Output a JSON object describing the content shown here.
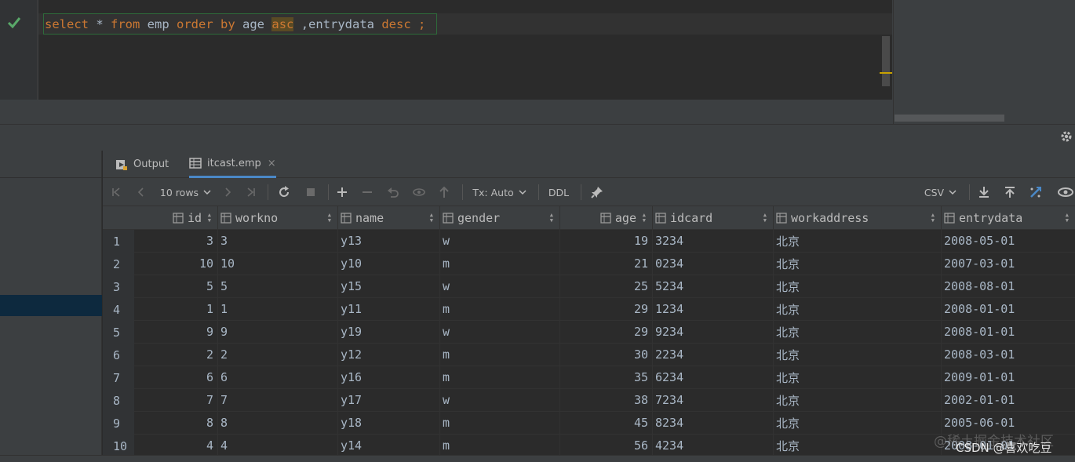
{
  "editor": {
    "query_tokens": [
      {
        "t": "select",
        "c": "kw"
      },
      {
        "t": " * ",
        "c": "plain"
      },
      {
        "t": "from",
        "c": "kw"
      },
      {
        "t": " emp ",
        "c": "plain"
      },
      {
        "t": "order",
        "c": "kw"
      },
      {
        "t": " ",
        "c": "plain"
      },
      {
        "t": "by",
        "c": "kw"
      },
      {
        "t": " age ",
        "c": "fn"
      },
      {
        "t": "asc",
        "c": "hl"
      },
      {
        "t": " ,entrydata ",
        "c": "fn"
      },
      {
        "t": "desc",
        "c": "kw"
      },
      {
        "t": " ;",
        "c": "kw"
      }
    ],
    "status_icon": "check-icon"
  },
  "tabs": [
    {
      "label": "Output",
      "icon": "output-icon",
      "active": false
    },
    {
      "label": "itcast.emp",
      "icon": "table-icon",
      "active": true,
      "close": "×"
    }
  ],
  "toolbar": {
    "rows_label": "10 rows",
    "tx_label": "Tx: Auto",
    "ddl_label": "DDL",
    "export_label": "CSV"
  },
  "grid": {
    "columns": [
      "id",
      "workno",
      "name",
      "gender",
      "age",
      "idcard",
      "workaddress",
      "entrydata"
    ],
    "rows": [
      {
        "n": "1",
        "id": "3",
        "workno": "3",
        "name": "y13",
        "gender": "w",
        "age": "19",
        "idcard": "3234",
        "workaddress": "北京",
        "entrydata": "2008-05-01"
      },
      {
        "n": "2",
        "id": "10",
        "workno": "10",
        "name": "y10",
        "gender": "m",
        "age": "21",
        "idcard": "0234",
        "workaddress": "北京",
        "entrydata": "2007-03-01"
      },
      {
        "n": "3",
        "id": "5",
        "workno": "5",
        "name": "y15",
        "gender": "w",
        "age": "25",
        "idcard": "5234",
        "workaddress": "北京",
        "entrydata": "2008-08-01"
      },
      {
        "n": "4",
        "id": "1",
        "workno": "1",
        "name": "y11",
        "gender": "m",
        "age": "29",
        "idcard": "1234",
        "workaddress": "北京",
        "entrydata": "2008-01-01"
      },
      {
        "n": "5",
        "id": "9",
        "workno": "9",
        "name": "y19",
        "gender": "w",
        "age": "29",
        "idcard": "9234",
        "workaddress": "北京",
        "entrydata": "2008-01-01"
      },
      {
        "n": "6",
        "id": "2",
        "workno": "2",
        "name": "y12",
        "gender": "m",
        "age": "30",
        "idcard": "2234",
        "workaddress": "北京",
        "entrydata": "2008-03-01"
      },
      {
        "n": "7",
        "id": "6",
        "workno": "6",
        "name": "y16",
        "gender": "m",
        "age": "35",
        "idcard": "6234",
        "workaddress": "北京",
        "entrydata": "2009-01-01"
      },
      {
        "n": "8",
        "id": "7",
        "workno": "7",
        "name": "y17",
        "gender": "w",
        "age": "38",
        "idcard": "7234",
        "workaddress": "北京",
        "entrydata": "2002-01-01"
      },
      {
        "n": "9",
        "id": "8",
        "workno": "8",
        "name": "y18",
        "gender": "m",
        "age": "45",
        "idcard": "8234",
        "workaddress": "北京",
        "entrydata": "2005-06-01"
      },
      {
        "n": "10",
        "id": "4",
        "workno": "4",
        "name": "y14",
        "gender": "m",
        "age": "56",
        "idcard": "4234",
        "workaddress": "北京",
        "entrydata": "2008-01-01"
      }
    ]
  },
  "watermark": {
    "site": "@稀土掘金技术社区",
    "credit": "CSDN @喜欢吃豆"
  },
  "colors": {
    "keyword": "#cc7832",
    "identifier": "#a9b7c6",
    "success": "#59a869",
    "accent": "#4a88c7"
  }
}
